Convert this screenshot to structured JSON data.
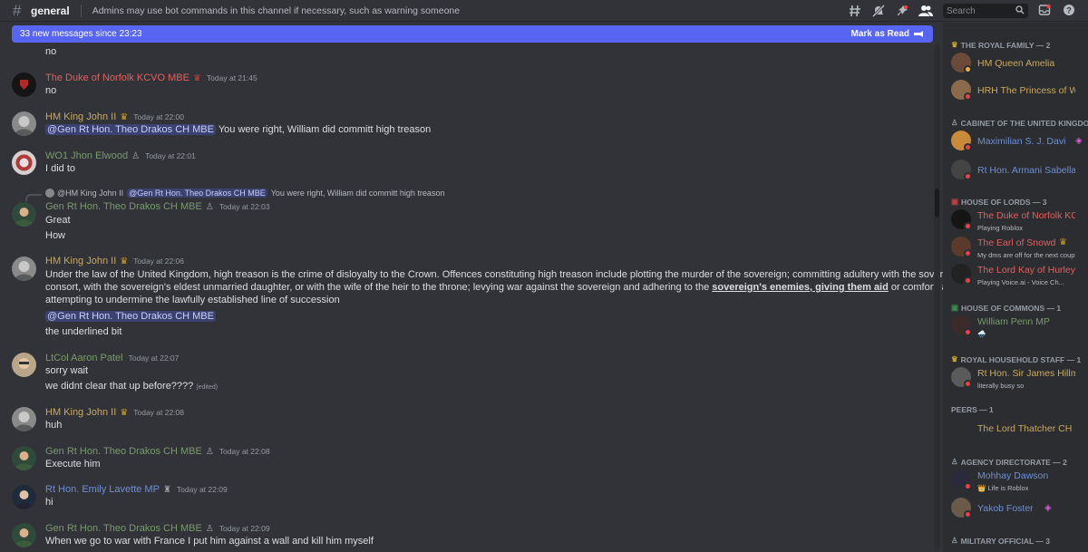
{
  "channel": {
    "name": "general",
    "topic": "Admins may use bot commands in this channel if necessary, such as warning someone"
  },
  "header_icons": [
    "threads-icon",
    "mute-icon",
    "pin-icon",
    "members-icon"
  ],
  "search": {
    "placeholder": "Search"
  },
  "new_messages": {
    "text": "33 new messages since 23:23",
    "action": "Mark as Read"
  },
  "colors": {
    "accent": "#5865f2",
    "green_role": "#7a9a6e",
    "gold_role": "#c9a95c",
    "red_role": "#e06060",
    "blue_role": "#6d8fd6"
  },
  "messages": [
    {
      "author": "",
      "time": "",
      "lines": [
        "no"
      ]
    },
    {
      "author": "The Duke of Norfolk KCVO MBE",
      "time": "Today at 21:45",
      "lines": [
        "no"
      ]
    },
    {
      "author": "HM King John II",
      "time": "Today at 22:00",
      "mention": "@Gen Rt Hon. Theo Drakos CH MBE",
      "text": "You were right, William did committ high treason"
    },
    {
      "author": "WO1 Jhon Elwood",
      "time": "Today at 22:01",
      "lines": [
        "I did to"
      ]
    },
    {
      "reply_author": "@HM King John II",
      "reply_mention": "@Gen Rt Hon. Theo Drakos CH MBE",
      "reply_text": "You were right, William did committ high treason",
      "author": "Gen Rt Hon. Theo Drakos CH MBE",
      "time": "Today at 22:03",
      "lines": [
        "Great",
        "How"
      ]
    },
    {
      "author": "HM King John II",
      "time": "Today at 22:06",
      "para1": "Under the law of the United Kingdom, high treason is the crime of disloyalty to the Crown. Offences constituting high treason include plotting the murder of the sovereign; committing adultery with the sovereign's",
      "para2": "consort, with the sovereign's eldest unmarried daughter, or with the wife of the heir to the throne; levying war against the sovereign and adhering to the",
      "underlined": "sovereign's enemies, giving them aid",
      "para2_end": "or comfort; and",
      "para3": "attempting to undermine the lawfully established line of succession",
      "mention": "@Gen Rt Hon. Theo Drakos CH MBE",
      "after": "the underlined bit"
    },
    {
      "author": "LtCol Aaron Patel",
      "time": "Today at 22:07",
      "lines": [
        "sorry wait",
        "we didnt clear that up before????"
      ],
      "edited": "(edited)"
    },
    {
      "author": "HM King John II",
      "time": "Today at 22:08",
      "lines": [
        "huh"
      ]
    },
    {
      "author": "Gen Rt Hon. Theo Drakos CH MBE",
      "time": "Today at 22:08",
      "lines": [
        "Execute him"
      ]
    },
    {
      "author": "Rt Hon. Emily Lavette MP",
      "time": "Today at 22:09",
      "lines": [
        "hi"
      ]
    },
    {
      "author": "Gen Rt Hon. Theo Drakos CH MBE",
      "time": "Today at 22:09",
      "lines": [
        "When we go to war with France I put him against a wall and kill him myself"
      ]
    }
  ],
  "member_groups": [
    {
      "title": "THE ROYAL FAMILY — 2",
      "members": [
        {
          "name": "HM Queen Amelia",
          "status": ""
        },
        {
          "name": "HRH The Princess of Wales",
          "status": ""
        }
      ]
    },
    {
      "title": "CABINET OF THE UNITED KINGDOM — 2",
      "members": [
        {
          "name": "Maximilian S. J. Davies",
          "status": ""
        },
        {
          "name": "Rt Hon. Armani Sabella",
          "status": ""
        }
      ]
    },
    {
      "title": "HOUSE OF LORDS — 3",
      "members": [
        {
          "name": "The Duke of Norfolk KCVO MBE",
          "status": "Playing Roblox"
        },
        {
          "name": "The Earl of Snowdon",
          "status": "My dms are off for the next couple"
        },
        {
          "name": "The Lord Kay of Hurley",
          "status": "Playing Voice.ai - Voice Ch..."
        }
      ]
    },
    {
      "title": "HOUSE OF COMMONS — 1",
      "members": [
        {
          "name": "William Penn MP",
          "status": "🌧️"
        }
      ]
    },
    {
      "title": "ROYAL HOUSEHOLD STAFF — 1",
      "members": [
        {
          "name": "Rt Hon. Sir James Hillman",
          "status": "literally busy so"
        }
      ]
    },
    {
      "title": "PEERS — 1",
      "members": [
        {
          "name": "The Lord Thatcher CH",
          "status": ""
        }
      ]
    },
    {
      "title": "AGENCY DIRECTORATE — 2",
      "members": [
        {
          "name": "Mohhay Dawson",
          "status": "👑 Life is Roblox"
        },
        {
          "name": "Yakob Foster",
          "status": ""
        }
      ]
    },
    {
      "title": "MILITARY OFFICIAL — 3",
      "members": []
    }
  ]
}
